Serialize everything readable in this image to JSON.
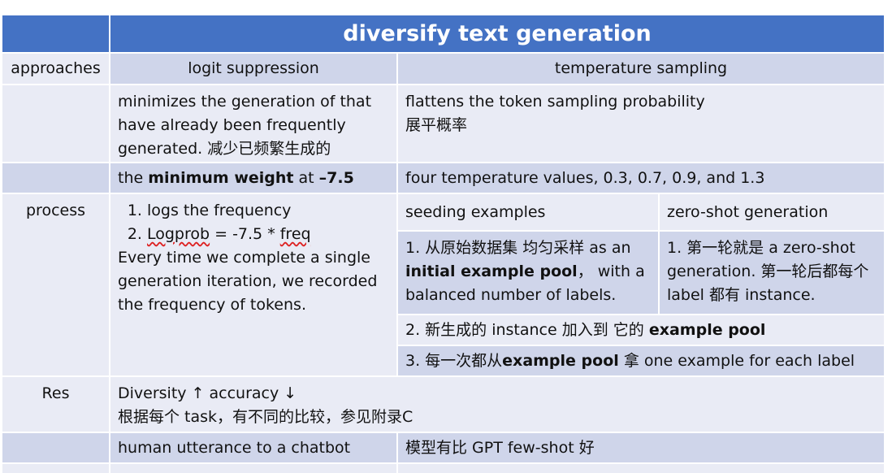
{
  "title": "diversify text generation",
  "labels": {
    "approaches": "approaches",
    "process": "process",
    "res": "Res"
  },
  "headers": {
    "logit": "logit suppression",
    "temp": "temperature sampling"
  },
  "rows": {
    "def_logit": "minimizes the generation of that have already been frequently generated. 减少已频繁生成的",
    "def_temp_en": "flattens the token sampling probability",
    "def_temp_zh": "展平概率",
    "weight_pre": "the ",
    "weight_bold": "minimum weight",
    "weight_mid": " at ",
    "weight_val": "–7.5",
    "temps": "four temperature values, 0.3, 0.7, 0.9, and 1.3"
  },
  "process": {
    "step1": "logs the frequency",
    "step2_a": "Logprob",
    "step2_b": " = -7.5 * ",
    "step2_c": "freq",
    "desc": "Every time we complete a single generation iteration, we recorded the frequency of tokens.",
    "seeding_header": "seeding examples",
    "zeroshot_header": "zero-shot generation",
    "seed1_a": "1. 从原始数据集 均匀采样 as an ",
    "seed1_b": "initial example pool",
    "seed1_c": "， with a balanced number of labels.",
    "zero1": "1. 第一轮就是 a zero-shot generation. 第一轮后都每个label 都有 instance.",
    "step_new_a": "2. 新生成的 instance 加入到 它的 ",
    "step_new_b": "example pool",
    "step_take_a": "3. 每一次都从",
    "step_take_b": "example pool",
    "step_take_c": " 拿 one example for each label"
  },
  "result": {
    "line1": "Diversity ↑ accuracy ↓",
    "line2": "根据每个 task，有不同的比较，参见附录C",
    "utterance": "human utterance to a chatbot",
    "model": "模型有比 GPT few-shot 好"
  }
}
